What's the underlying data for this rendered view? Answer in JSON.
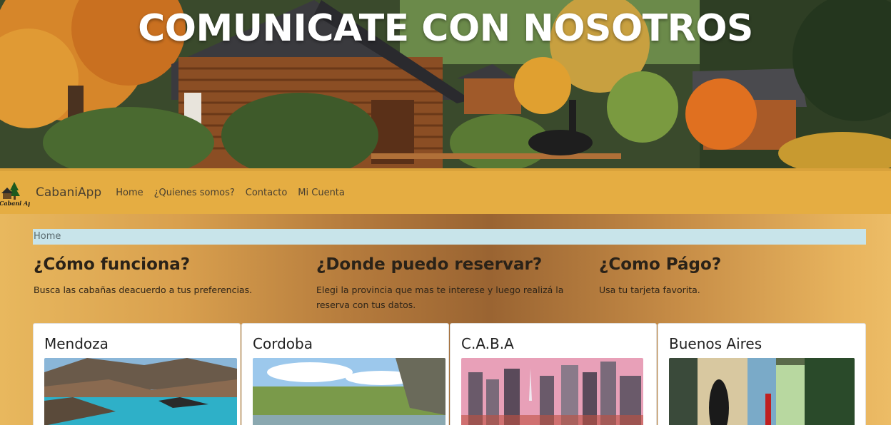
{
  "hero": {
    "title": "COMUNICATE CON NOSOTROS"
  },
  "navbar": {
    "brand": "CabaniApp",
    "logo_text": "Cabani App",
    "links": [
      {
        "label": "Home"
      },
      {
        "label": "¿Quienes somos?"
      },
      {
        "label": "Contacto"
      },
      {
        "label": "Mi Cuenta"
      }
    ]
  },
  "breadcrumb": {
    "current": "Home"
  },
  "info": [
    {
      "title": "¿Cómo funciona?",
      "text": "Busca las cabañas deacuerdo a tus preferencias."
    },
    {
      "title": "¿Donde puedo reservar?",
      "text": "Elegi la provincia que mas te interese y luego realizá la reserva con tus datos."
    },
    {
      "title": "¿Como Págo?",
      "text": "Usa tu tarjeta favorita."
    }
  ],
  "cards": [
    {
      "title": "Mendoza"
    },
    {
      "title": "Cordoba"
    },
    {
      "title": "C.A.B.A"
    },
    {
      "title": "Buenos Aires"
    }
  ],
  "colors": {
    "navbar": "#e5ad42",
    "breadcrumb_bg": "#c8e4ea",
    "hero_title": "#ffffff"
  }
}
